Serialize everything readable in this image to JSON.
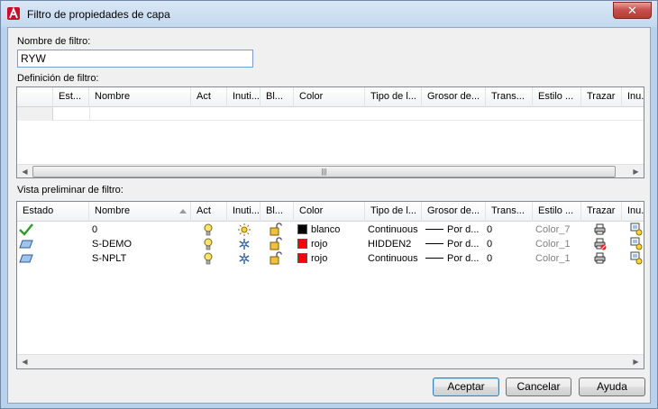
{
  "window": {
    "title": "Filtro de propiedades de capa",
    "close_symbol": "✕"
  },
  "filter_name": {
    "label": "Nombre de filtro:",
    "value": "RYW"
  },
  "definition": {
    "label": "Definición de filtro:",
    "columns": [
      "Est...",
      "Nombre",
      "Act",
      "Inuti...",
      "Bl...",
      "Color",
      "Tipo de l...",
      "Grosor de...",
      "Trans...",
      "Estilo ...",
      "Trazar",
      "Inu..."
    ]
  },
  "preview": {
    "label": "Vista preliminar de filtro:",
    "columns": [
      "Estado",
      "Nombre",
      "Act",
      "Inuti...",
      "Bl...",
      "Color",
      "Tipo de l...",
      "Grosor de...",
      "Trans...",
      "Estilo ...",
      "Trazar",
      "Inu..."
    ],
    "rows": [
      {
        "status_icon": "check-icon",
        "name": "0",
        "color_name": "blanco",
        "color_hex": "#000000",
        "linetype": "Continuous",
        "lineweight": "Por d...",
        "transparency": "0",
        "plot_style": "Color_7",
        "plot_icon": "printer-icon"
      },
      {
        "status_icon": "layer-icon",
        "name": "S-DEMO",
        "color_name": "rojo",
        "color_hex": "#ff0000",
        "linetype": "HIDDEN2",
        "lineweight": "Por d...",
        "transparency": "0",
        "plot_style": "Color_1",
        "plot_icon": "printer-no-plot-icon"
      },
      {
        "status_icon": "layer-icon",
        "name": "S-NPLT",
        "color_name": "rojo",
        "color_hex": "#ff0000",
        "linetype": "Continuous",
        "lineweight": "Por d...",
        "transparency": "0",
        "plot_style": "Color_1",
        "plot_icon": "printer-icon"
      }
    ]
  },
  "buttons": {
    "accept": "Aceptar",
    "cancel": "Cancelar",
    "help": "Ayuda"
  },
  "colors": {
    "accent": "#3c7fb1",
    "titlebar": "#c4d8ee"
  }
}
